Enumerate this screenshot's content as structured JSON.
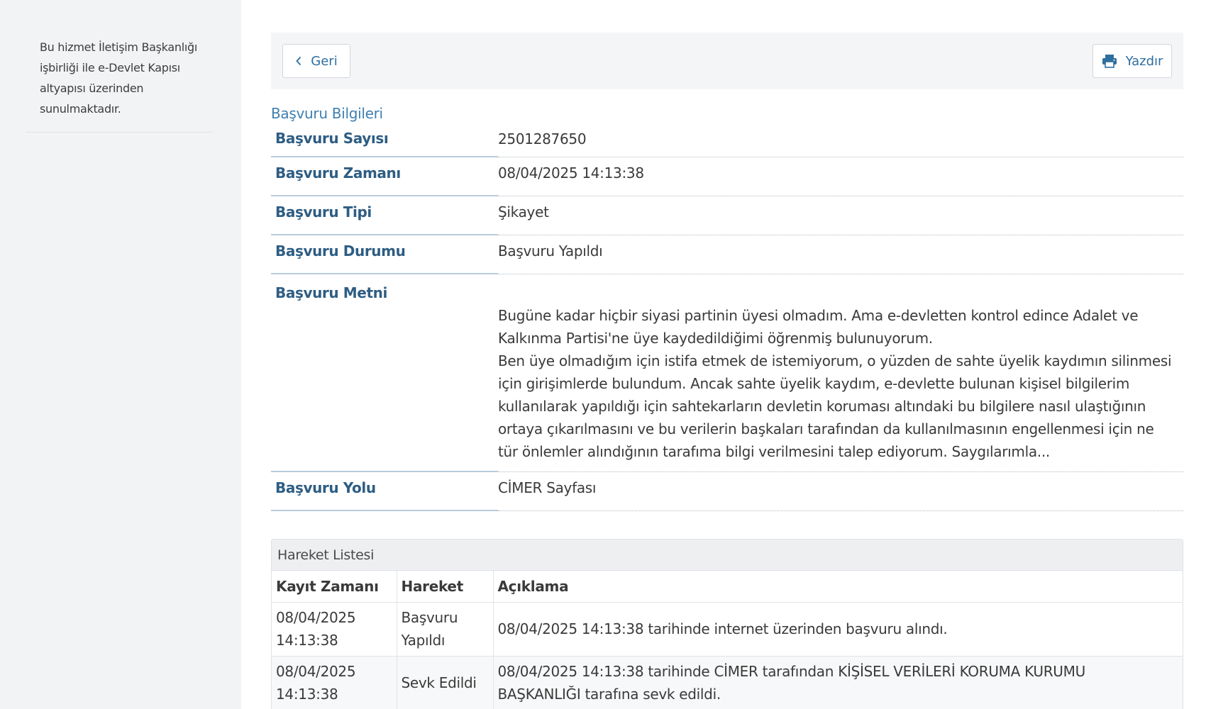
{
  "sidebar": {
    "note": "Bu hizmet İletişim Başkanlığı işbirliği ile e-Devlet Kapısı altyapısı üzerinden sunulmaktadır."
  },
  "toolbar": {
    "back_label": "Geri",
    "print_label": "Yazdır"
  },
  "section_title": "Başvuru Bilgileri",
  "info": {
    "number_label": "Başvuru Sayısı",
    "number_value": "2501287650",
    "time_label": "Başvuru Zamanı",
    "time_value": "08/04/2025 14:13:38",
    "type_label": "Başvuru Tipi",
    "type_value": "Şikayet",
    "status_label": "Başvuru Durumu",
    "status_value": "Başvuru Yapıldı",
    "text_label": "Başvuru Metni",
    "text_paragraph_1": "Bugüne kadar hiçbir siyasi partinin üyesi olmadım. Ama e-devletten kontrol edince Adalet ve Kalkınma Partisi'ne üye kaydedildiğimi öğrenmiş bulunuyorum.",
    "text_paragraph_2": "Ben üye olmadığım için istifa etmek de istemiyorum, o yüzden de sahte üyelik kaydımın silinmesi için girişimlerde bulundum. Ancak sahte üyelik kaydım, e-devlette bulunan kişisel bilgilerim kullanılarak yapıldığı için sahtekarların devletin koruması altındaki bu bilgilere nasıl ulaştığının ortaya çıkarılmasını ve bu verilerin başkaları tarafından da kullanılmasının engellenmesi için ne tür önlemler alındığının tarafıma bilgi verilmesini talep ediyorum. Saygılarımla...",
    "channel_label": "Başvuru Yolu",
    "channel_value": "CİMER Sayfası"
  },
  "movements": {
    "title": "Hareket Listesi",
    "headers": [
      "Kayıt Zamanı",
      "Hareket",
      "Açıklama"
    ],
    "rows": [
      {
        "date": "08/04/2025",
        "time": "14:13:38",
        "action_line1": "Başvuru",
        "action_line2": "Yapıldı",
        "description": "08/04/2025 14:13:38 tarihinde internet üzerinden başvuru alındı."
      },
      {
        "date": "08/04/2025",
        "time": "14:13:38",
        "action_line1": "Sevk Edildi",
        "action_line2": "",
        "description_line1": "08/04/2025 14:13:38 tarihinde CİMER tarafından KİŞİSEL VERİLERİ KORUMA KURUMU",
        "description_line2": "BAŞKANLIĞI tarafına sevk edildi."
      }
    ]
  }
}
